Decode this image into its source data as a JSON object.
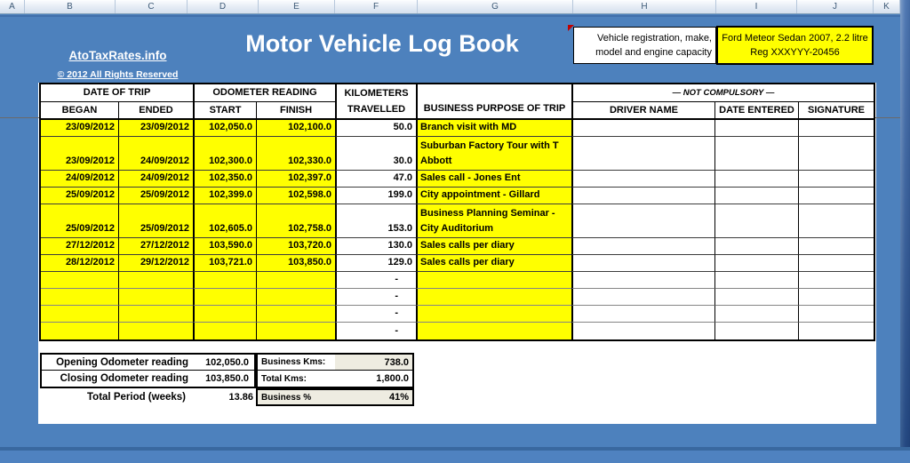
{
  "sheet": {
    "column_headers": [
      "A",
      "B",
      "C",
      "D",
      "E",
      "F",
      "G",
      "H",
      "I",
      "J",
      "K"
    ]
  },
  "branding": {
    "site_link": "AtoTaxRates.info",
    "copyright": "© 2012 All Rights Reserved"
  },
  "title": "Motor Vehicle Log Book",
  "vehicle_info": {
    "label": "Vehicle registration, make, model and engine capacity",
    "value": "Ford Meteor Sedan 2007, 2.2 litre Reg XXXYYY-20456"
  },
  "log_table": {
    "headers": {
      "date_of_trip": "DATE OF TRIP",
      "began": "BEGAN",
      "ended": "ENDED",
      "odometer_reading": "ODOMETER READING",
      "start": "START",
      "finish": "FINISH",
      "kilometers_line1": "KILOMETERS",
      "kilometers_line2": "TRAVELLED",
      "purpose": "BUSINESS PURPOSE OF TRIP",
      "not_compulsory": "— NOT COMPULSORY —",
      "driver_name": "DRIVER NAME",
      "date_entered": "DATE ENTERED",
      "signature": "SIGNATURE"
    },
    "rows": [
      {
        "began": "23/09/2012",
        "ended": "23/09/2012",
        "start": "102,050.0",
        "finish": "102,100.0",
        "km": "50.0",
        "purpose": "Branch visit with MD",
        "tall": false,
        "empty": false
      },
      {
        "began": "23/09/2012",
        "ended": "24/09/2012",
        "start": "102,300.0",
        "finish": "102,330.0",
        "km": "30.0",
        "purpose": "Suburban Factory Tour with T Abbott",
        "tall": true,
        "empty": false
      },
      {
        "began": "24/09/2012",
        "ended": "24/09/2012",
        "start": "102,350.0",
        "finish": "102,397.0",
        "km": "47.0",
        "purpose": "Sales call - Jones Ent",
        "tall": false,
        "empty": false
      },
      {
        "began": "25/09/2012",
        "ended": "25/09/2012",
        "start": "102,399.0",
        "finish": "102,598.0",
        "km": "199.0",
        "purpose": "City appointment - Gillard",
        "tall": false,
        "empty": false
      },
      {
        "began": "25/09/2012",
        "ended": "25/09/2012",
        "start": "102,605.0",
        "finish": "102,758.0",
        "km": "153.0",
        "purpose": "Business Planning Seminar - City Auditorium",
        "tall": true,
        "empty": false
      },
      {
        "began": "27/12/2012",
        "ended": "27/12/2012",
        "start": "103,590.0",
        "finish": "103,720.0",
        "km": "130.0",
        "purpose": "Sales calls per diary",
        "tall": false,
        "empty": false
      },
      {
        "began": "28/12/2012",
        "ended": "29/12/2012",
        "start": "103,721.0",
        "finish": "103,850.0",
        "km": "129.0",
        "purpose": "Sales calls per diary",
        "tall": false,
        "empty": false
      },
      {
        "began": "",
        "ended": "",
        "start": "",
        "finish": "",
        "km": "-",
        "purpose": "",
        "tall": false,
        "empty": true
      },
      {
        "began": "",
        "ended": "",
        "start": "",
        "finish": "",
        "km": "-",
        "purpose": "",
        "tall": false,
        "empty": true
      },
      {
        "began": "",
        "ended": "",
        "start": "",
        "finish": "",
        "km": "-",
        "purpose": "",
        "tall": false,
        "empty": true
      },
      {
        "began": "",
        "ended": "",
        "start": "",
        "finish": "",
        "km": "-",
        "purpose": "",
        "tall": false,
        "empty": true
      }
    ]
  },
  "summary": {
    "opening_label": "Opening Odometer reading",
    "opening_value": "102,050.0",
    "closing_label": "Closing Odometer reading",
    "closing_value": "103,850.0",
    "period_label": "Total Period (weeks)",
    "period_value": "13.86",
    "business_kms_label": "Business Kms:",
    "business_kms_value": "738.0",
    "total_kms_label": "Total Kms:",
    "total_kms_value": "1,800.0",
    "business_pct_label": "Business %",
    "business_pct_value": "41%"
  },
  "colors": {
    "accent_blue": "#4d81bd",
    "highlight_yellow": "#ffff00",
    "shaded_beige": "#eeece1"
  }
}
